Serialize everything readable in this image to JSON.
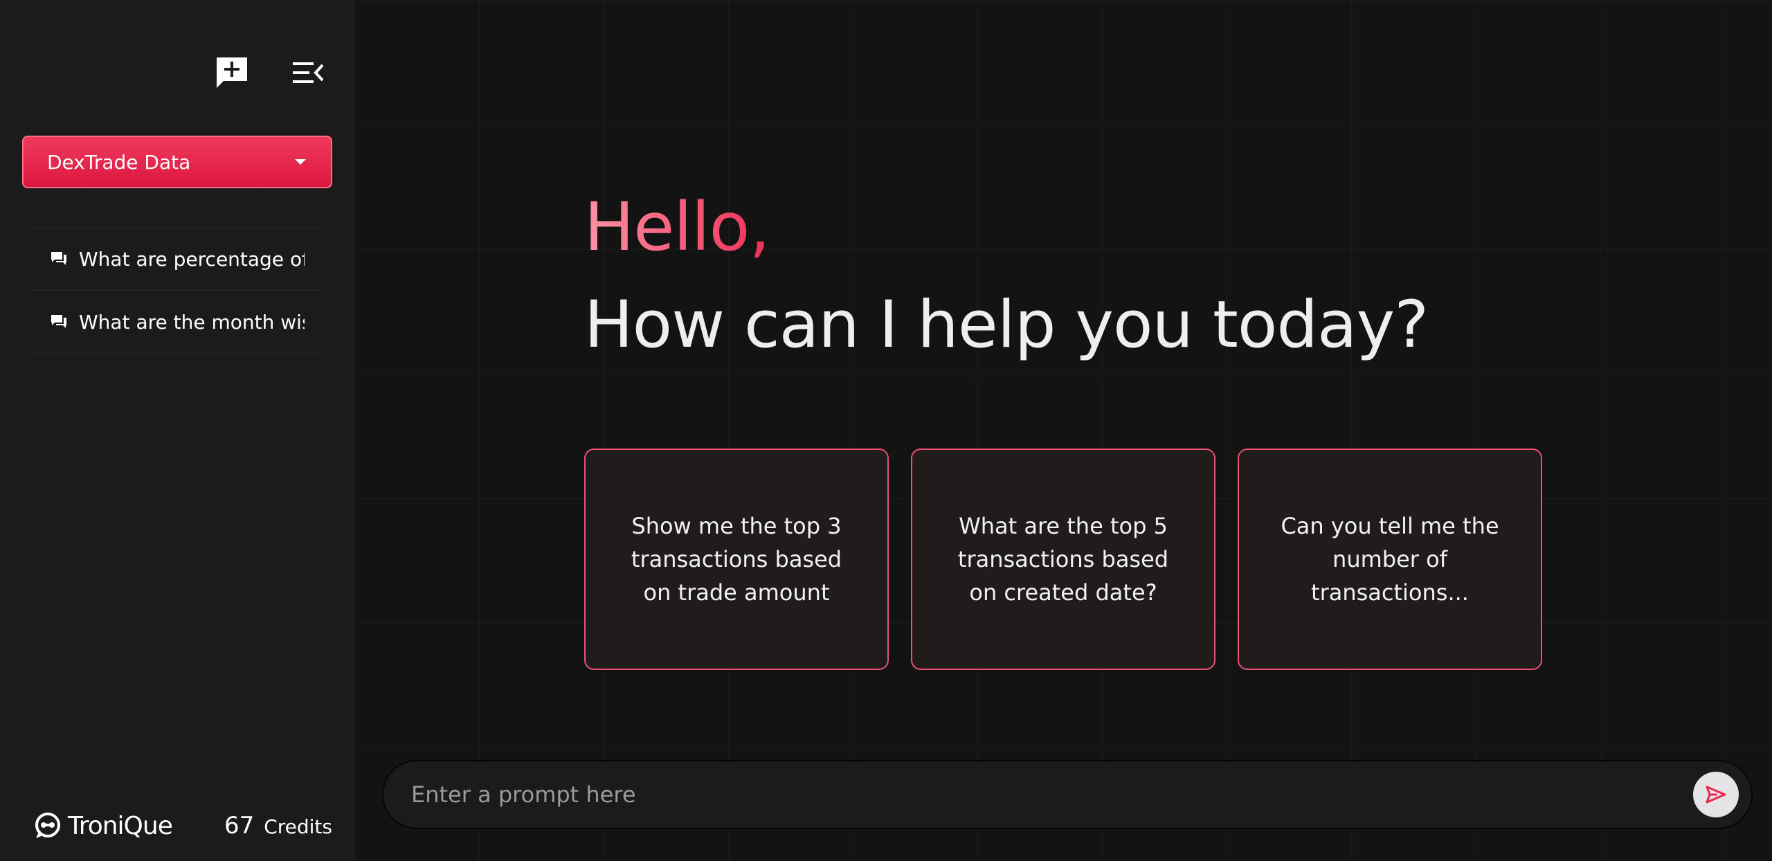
{
  "sidebar": {
    "new_chat_icon": "chat-plus-icon",
    "collapse_icon": "collapse-menu-icon",
    "database_select": {
      "selected": "DexTrade Data",
      "icon": "caret-down-icon"
    },
    "history": [
      {
        "icon": "chat-bubbles-icon",
        "label": "What are percentage of"
      },
      {
        "icon": "chat-bubbles-icon",
        "label": "What are the month wise"
      }
    ],
    "footer": {
      "brand": "TroniQue",
      "credits_count": "67",
      "credits_label": "Credits"
    }
  },
  "main": {
    "greeting": "Hello,",
    "headline": "How can I help you today?",
    "suggestions": [
      {
        "text": "Show me the top 3 transactions based on trade amount"
      },
      {
        "text": "What are the top 5 transactions based on created date?"
      },
      {
        "text": "Can you tell me the number of transactions..."
      }
    ],
    "prompt": {
      "placeholder": "Enter a prompt here",
      "value": "",
      "send_icon": "send-icon"
    }
  },
  "colors": {
    "accent": "#e8284d",
    "accent_light": "#ff91a6",
    "sidebar_bg": "#1b1b1b",
    "main_bg": "#131313",
    "card_bg": "#201c1c"
  }
}
